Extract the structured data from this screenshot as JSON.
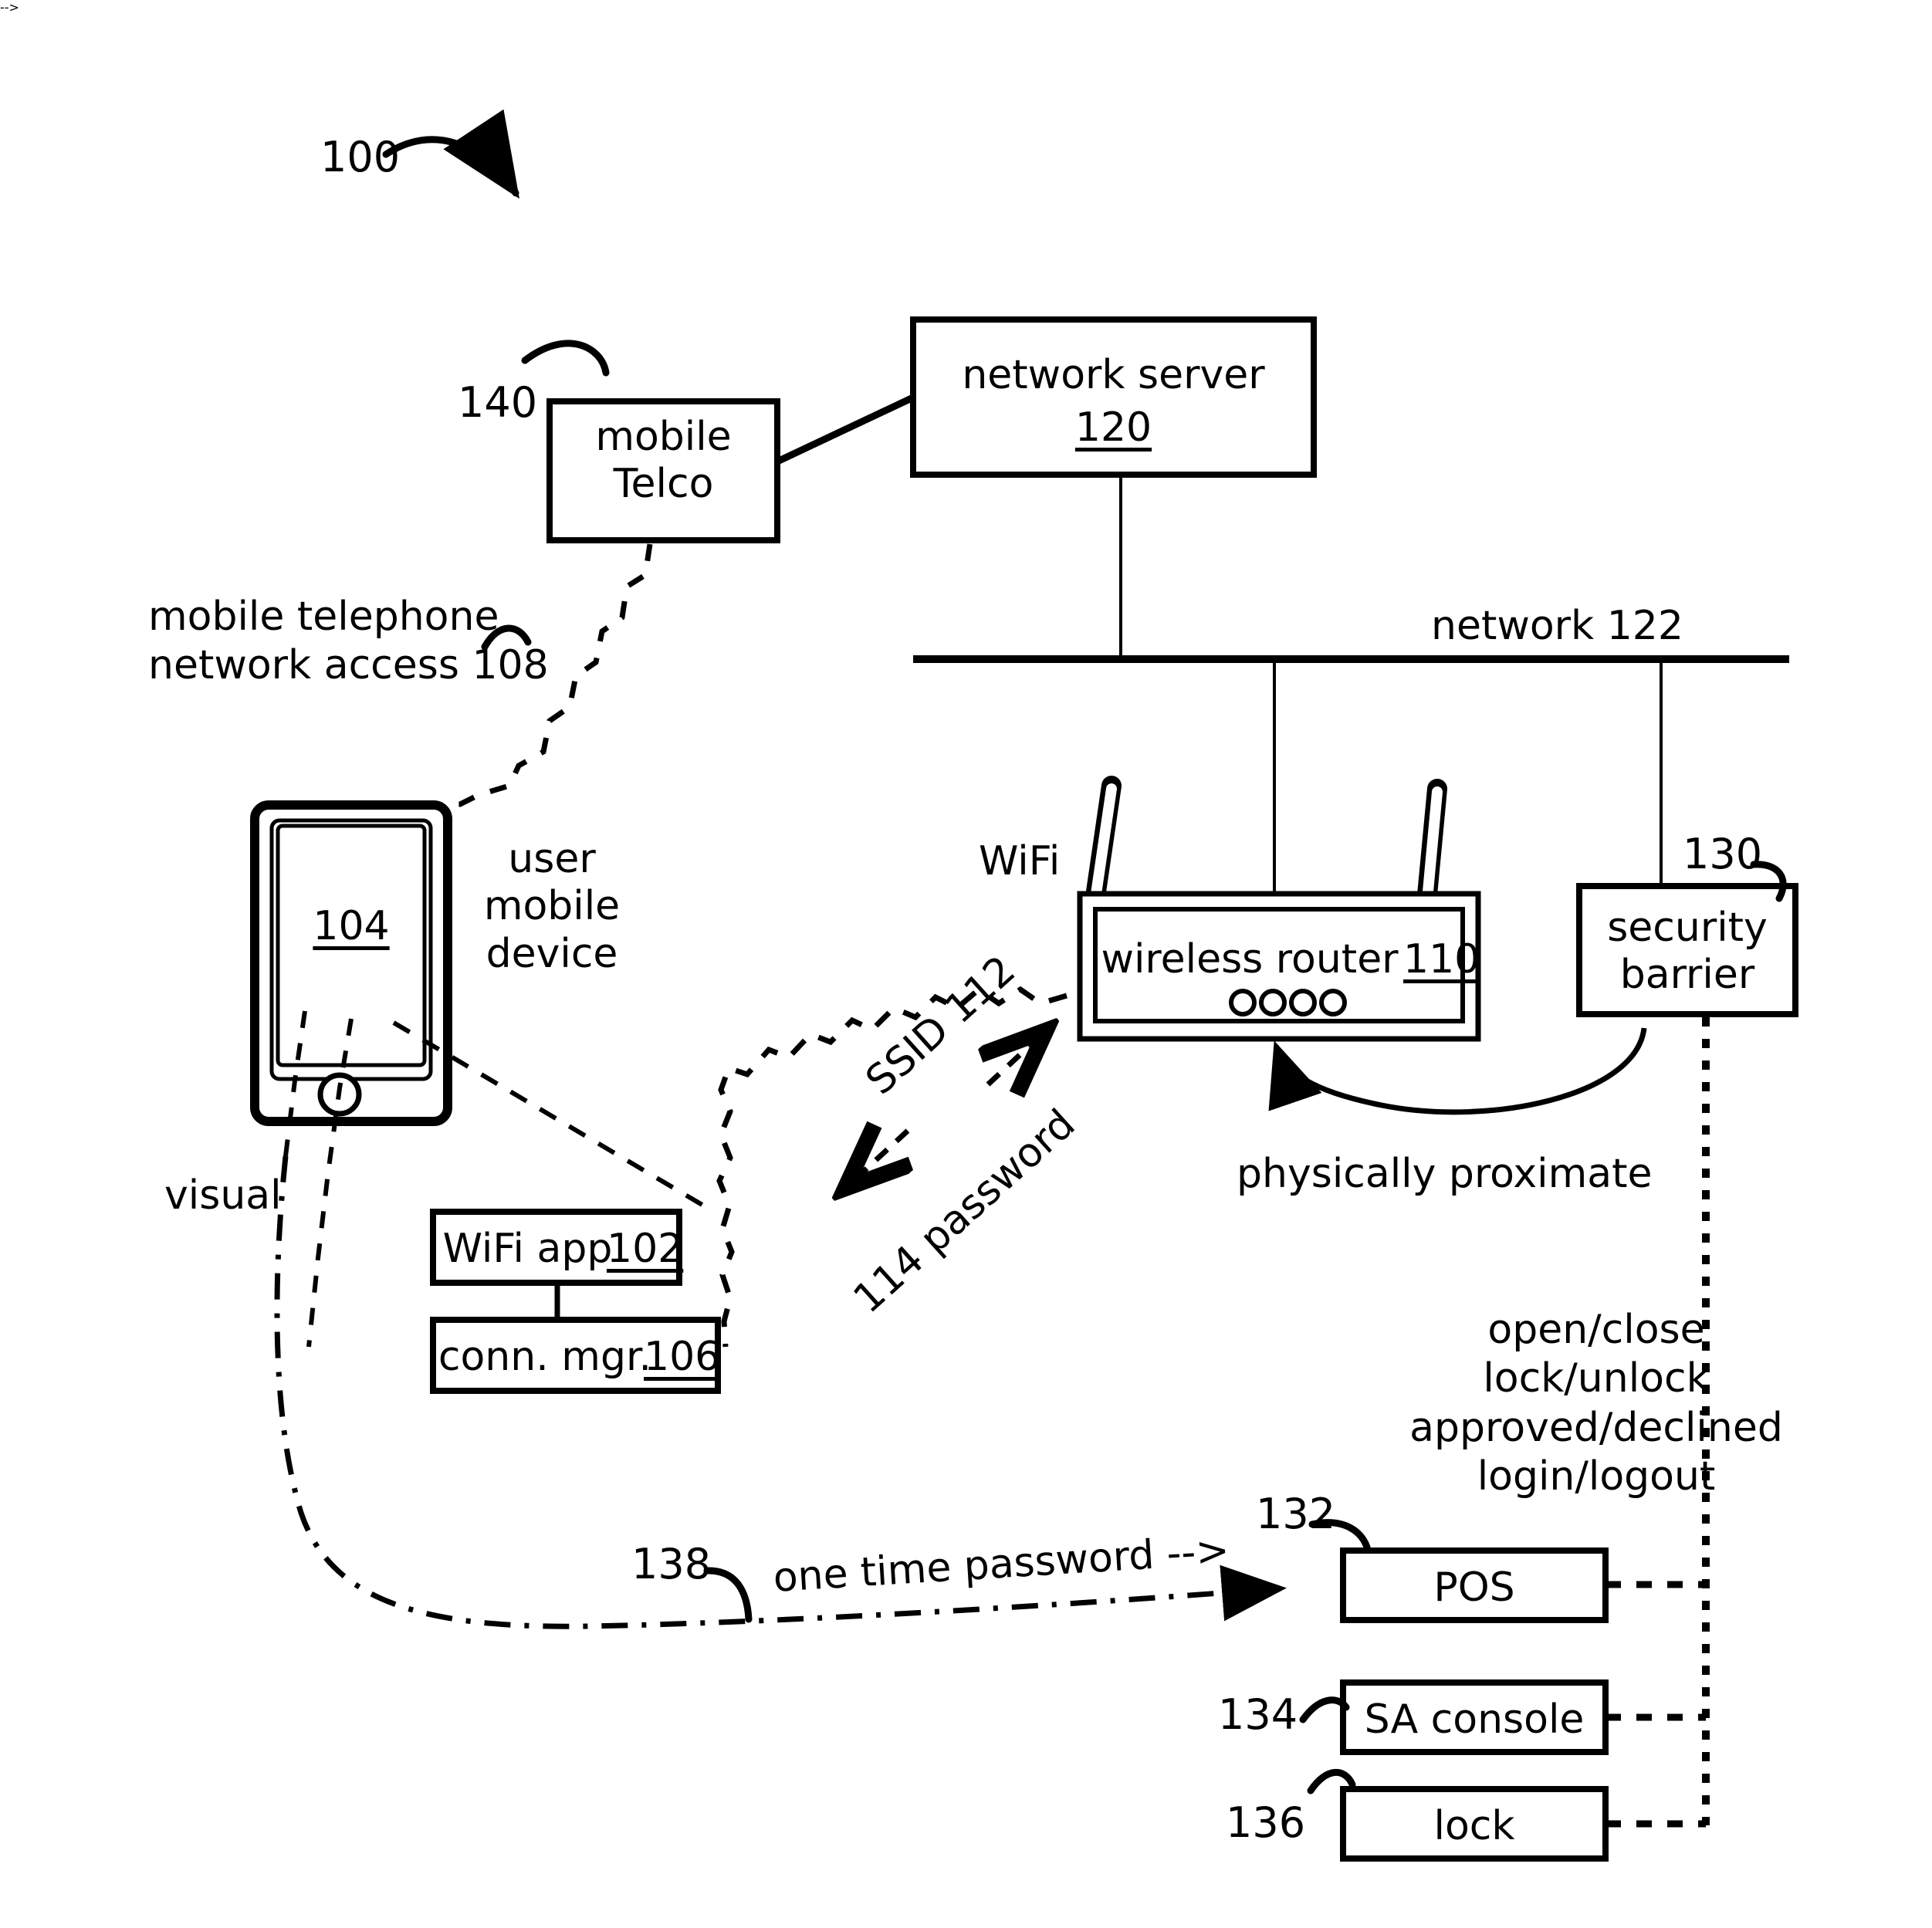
{
  "figure": {
    "ref_label": "100",
    "title_absent": true
  },
  "boxes": {
    "mobile_telco": {
      "label": "mobile\nTelco",
      "ref": "140"
    },
    "network_server": {
      "label": "network server",
      "ref": "120"
    },
    "wireless_router": {
      "label": "wireless router",
      "ref": "110"
    },
    "security_barrier": {
      "label": "security\nbarrier",
      "ref": "130"
    },
    "wifi_app": {
      "label": "WiFi app",
      "ref": "102"
    },
    "conn_mgr": {
      "label": "conn. mgr.",
      "ref": "106"
    },
    "pos": {
      "label": "POS",
      "ref": "132"
    },
    "sa_console": {
      "label": "SA console",
      "ref": "134"
    },
    "lock": {
      "label": "lock",
      "ref": "136"
    },
    "user_mobile_device": {
      "label": "user\nmobile\ndevice",
      "ref": "104"
    }
  },
  "labels": {
    "mobile_network_access": "mobile telephone\nnetwork access 108",
    "network_bus": "network 122",
    "wifi": "WiFi",
    "ssid": "SSID 112",
    "password": "114 password",
    "visual": "visual",
    "physically_proximate": "physically proximate",
    "one_time_password": "one time password -->",
    "one_time_password_ref": "138",
    "actions": "open/close\nlock/unlock\napproved/declined\nlogin/logout"
  },
  "colors": {
    "stroke": "#000000",
    "background": "#ffffff"
  }
}
